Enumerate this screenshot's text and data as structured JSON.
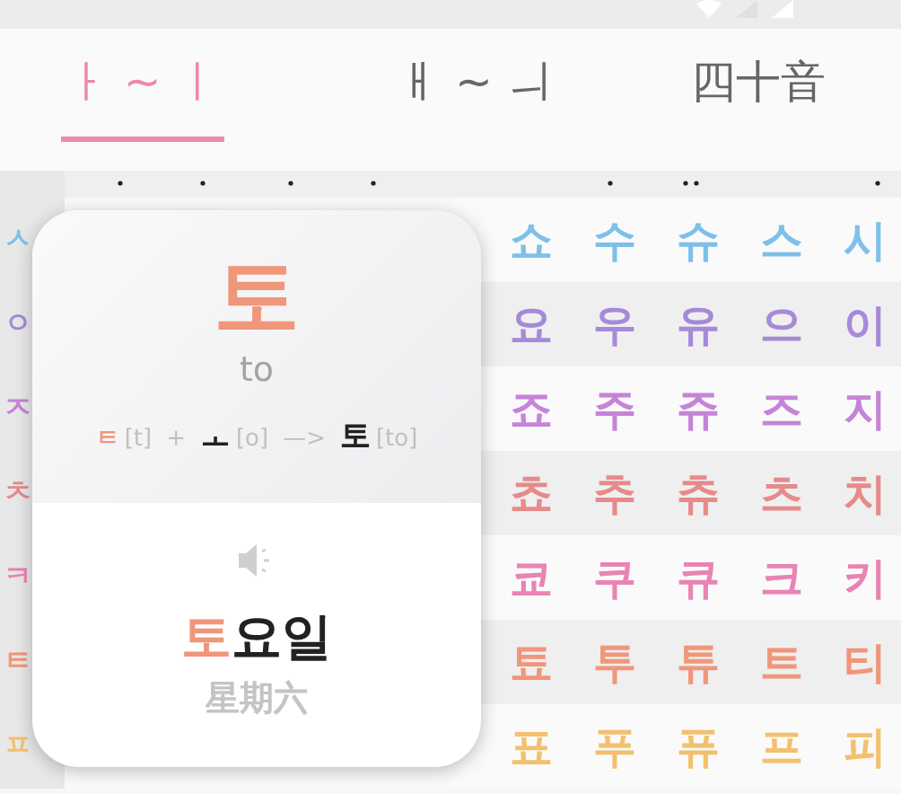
{
  "tabs": [
    {
      "label": "ㅏ ~ ㅣ",
      "selected": true
    },
    {
      "label": "ㅐ ~ ㅢ",
      "selected": false
    },
    {
      "label": "四十音",
      "selected": false
    }
  ],
  "rows": [
    {
      "consonant": "ㅅ",
      "color": "#7ec0ea",
      "syllables": [
        "쇼",
        "수",
        "슈",
        "스",
        "시"
      ]
    },
    {
      "consonant": "ㅇ",
      "color": "#a68ad9",
      "syllables": [
        "요",
        "우",
        "유",
        "으",
        "이"
      ]
    },
    {
      "consonant": "ㅈ",
      "color": "#c584d8",
      "syllables": [
        "죠",
        "주",
        "쥬",
        "즈",
        "지"
      ]
    },
    {
      "consonant": "ㅊ",
      "color": "#e68a8a",
      "syllables": [
        "쵸",
        "추",
        "츄",
        "츠",
        "치"
      ]
    },
    {
      "consonant": "ㅋ",
      "color": "#e884b4",
      "syllables": [
        "쿄",
        "쿠",
        "큐",
        "크",
        "키"
      ]
    },
    {
      "consonant": "ㅌ",
      "color": "#f0967a",
      "syllables": [
        "툐",
        "투",
        "튜",
        "트",
        "티"
      ]
    },
    {
      "consonant": "ㅍ",
      "color": "#f3c06e",
      "syllables": [
        "표",
        "푸",
        "퓨",
        "프",
        "피"
      ]
    }
  ],
  "card": {
    "syllable": "토",
    "romanization": "to",
    "formula": [
      {
        "kind": "consonant",
        "text": "ㅌ"
      },
      {
        "kind": "note",
        "text": "[t]"
      },
      {
        "kind": "op",
        "text": "+"
      },
      {
        "kind": "vowel",
        "text": "ㅗ"
      },
      {
        "kind": "note",
        "text": "[o]"
      },
      {
        "kind": "op",
        "text": "—>"
      },
      {
        "kind": "vowel",
        "text": "토"
      },
      {
        "kind": "note",
        "text": "[to]"
      }
    ],
    "word": [
      {
        "text": "토",
        "highlight": true
      },
      {
        "text": "요일",
        "highlight": false
      }
    ],
    "meaning": "星期六"
  }
}
